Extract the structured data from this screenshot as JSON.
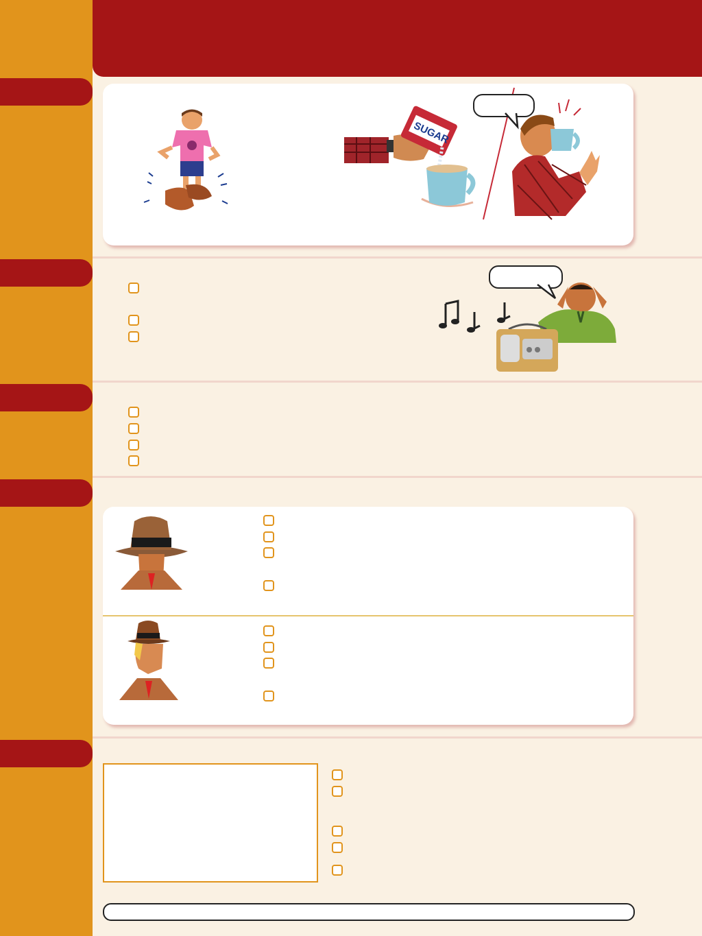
{
  "colors": {
    "sidebar": "#e1941c",
    "accent_red": "#a51516",
    "page_bg": "#faf1e3",
    "card_bg": "#ffffff",
    "checkbox_border": "#e1941c"
  },
  "header": {
    "title": ""
  },
  "sections": [
    {
      "id": "section-1",
      "label": ""
    },
    {
      "id": "section-2",
      "label": ""
    },
    {
      "id": "section-3",
      "label": ""
    },
    {
      "id": "section-4",
      "label": ""
    },
    {
      "id": "section-5",
      "label": ""
    }
  ],
  "speech_bubbles": {
    "drinking_man": "",
    "angry_man": ""
  },
  "icons": [
    "boy-big-shoes-illustration",
    "sugar-pouring-illustration",
    "man-drinking-illustration",
    "music-notes-icon",
    "radio-illustration",
    "angry-man-illustration",
    "detective-dark-hat-portrait",
    "detective-blond-portrait"
  ],
  "answer_field": {
    "value": ""
  }
}
